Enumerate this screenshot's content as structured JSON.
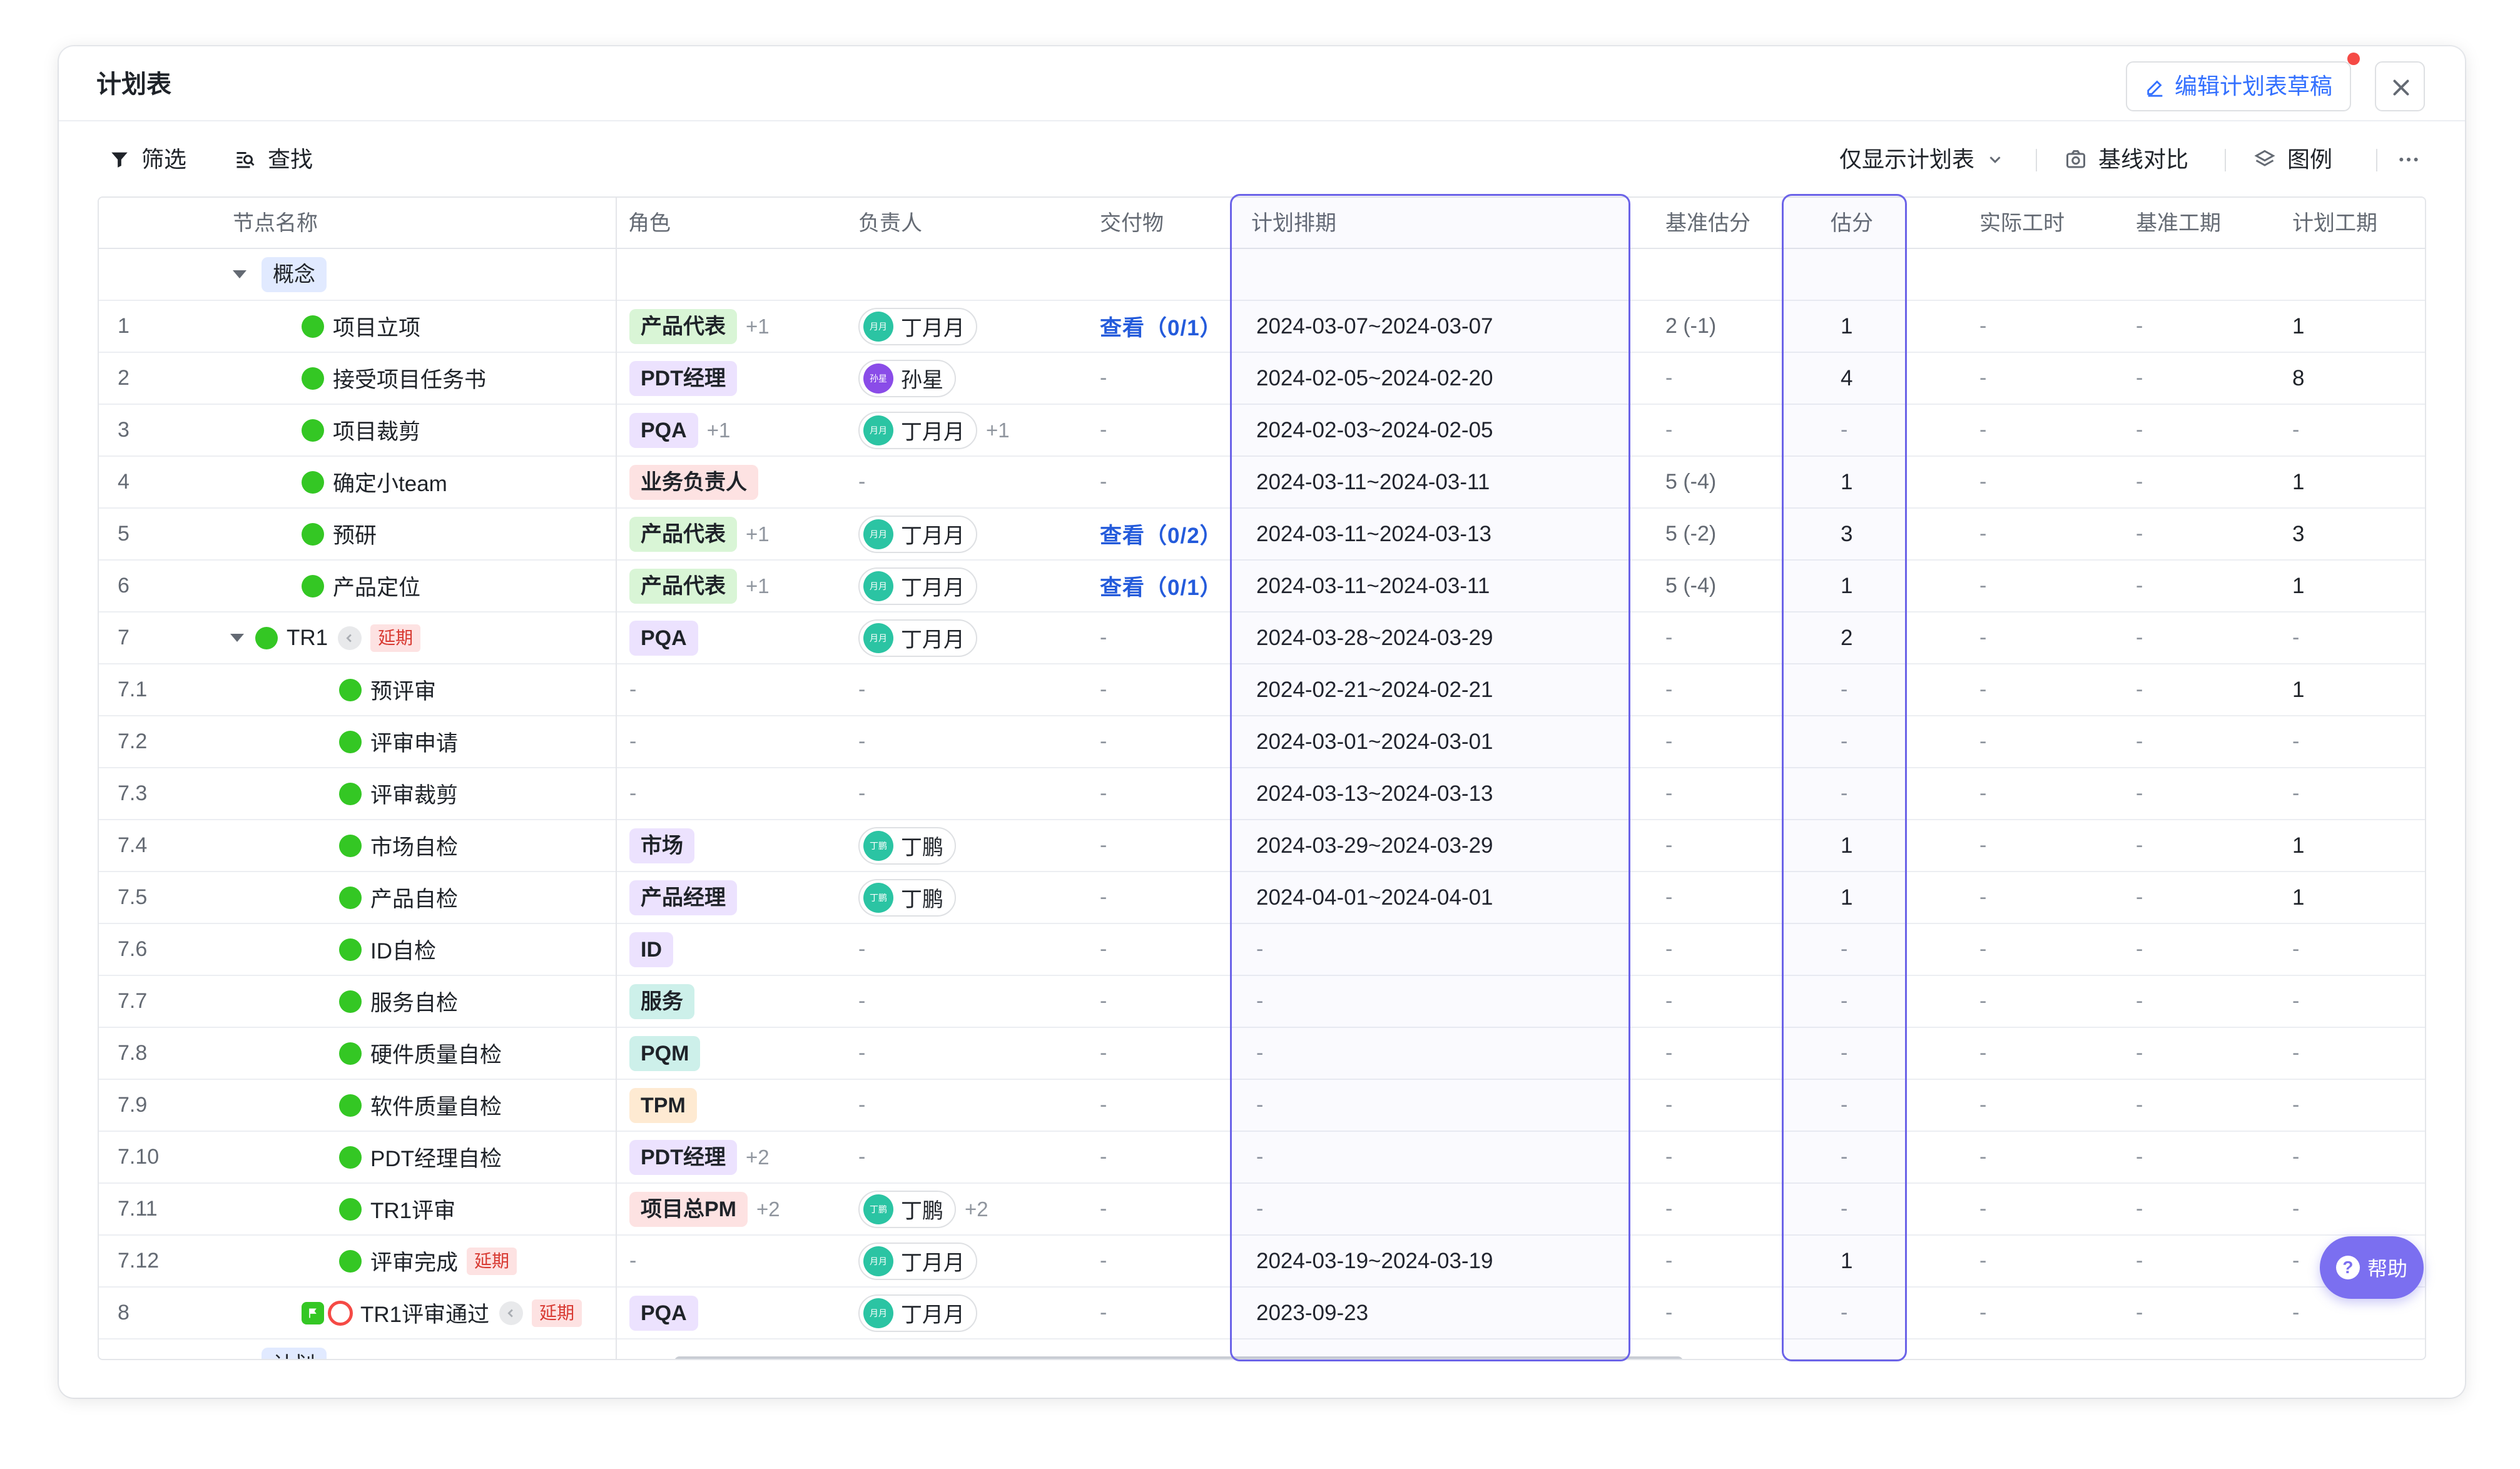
{
  "window": {
    "title": "计划表",
    "edit_button": "编辑计划表草稿"
  },
  "toolbar": {
    "filter": "筛选",
    "find": "查找",
    "show_only": "仅显示计划表",
    "baseline_compare": "基线对比",
    "legend": "图例"
  },
  "columns": [
    "节点名称",
    "角色",
    "负责人",
    "交付物",
    "计划排期",
    "基准估分",
    "估分",
    "实际工时",
    "基准工期",
    "计划工期"
  ],
  "groups": [
    "概念",
    "计划"
  ],
  "delay_tag": "延期",
  "help": "帮助",
  "rows": [
    {
      "no": "1",
      "name": "项目立项",
      "role": "产品代表",
      "role_plus": "+1",
      "owner": "丁月月",
      "owner_plus": "",
      "deliverable": "查看（0/1）",
      "schedule": "2024-03-07~2024-03-07",
      "base_est": "2 (-1)",
      "est": "1",
      "actual": "-",
      "base_dur": "-",
      "plan_dur": "1"
    },
    {
      "no": "2",
      "name": "接受项目任务书",
      "role": "PDT经理",
      "role_plus": "",
      "owner": "孙星",
      "owner_plus": "",
      "deliverable": "-",
      "schedule": "2024-02-05~2024-02-20",
      "base_est": "-",
      "est": "4",
      "actual": "-",
      "base_dur": "-",
      "plan_dur": "8"
    },
    {
      "no": "3",
      "name": "项目裁剪",
      "role": "PQA",
      "role_plus": "+1",
      "owner": "丁月月",
      "owner_plus": "+1",
      "deliverable": "-",
      "schedule": "2024-02-03~2024-02-05",
      "base_est": "-",
      "est": "-",
      "actual": "-",
      "base_dur": "-",
      "plan_dur": "-"
    },
    {
      "no": "4",
      "name": "确定小team",
      "role": "业务负责人",
      "role_plus": "",
      "owner": "-",
      "owner_plus": "",
      "deliverable": "-",
      "schedule": "2024-03-11~2024-03-11",
      "base_est": "5 (-4)",
      "est": "1",
      "actual": "-",
      "base_dur": "-",
      "plan_dur": "1"
    },
    {
      "no": "5",
      "name": "预研",
      "role": "产品代表",
      "role_plus": "+1",
      "owner": "丁月月",
      "owner_plus": "",
      "deliverable": "查看（0/2）",
      "schedule": "2024-03-11~2024-03-13",
      "base_est": "5 (-2)",
      "est": "3",
      "actual": "-",
      "base_dur": "-",
      "plan_dur": "3"
    },
    {
      "no": "6",
      "name": "产品定位",
      "role": "产品代表",
      "role_plus": "+1",
      "owner": "丁月月",
      "owner_plus": "",
      "deliverable": "查看（0/1）",
      "schedule": "2024-03-11~2024-03-11",
      "base_est": "5 (-4)",
      "est": "1",
      "actual": "-",
      "base_dur": "-",
      "plan_dur": "1"
    },
    {
      "no": "7",
      "name": "TR1",
      "role": "PQA",
      "role_plus": "",
      "owner": "丁月月",
      "owner_plus": "",
      "deliverable": "-",
      "schedule": "2024-03-28~2024-03-29",
      "base_est": "-",
      "est": "2",
      "actual": "-",
      "base_dur": "-",
      "plan_dur": "-"
    },
    {
      "no": "7.1",
      "name": "预评审",
      "role": "-",
      "role_plus": "",
      "owner": "-",
      "owner_plus": "",
      "deliverable": "-",
      "schedule": "2024-02-21~2024-02-21",
      "base_est": "-",
      "est": "-",
      "actual": "-",
      "base_dur": "-",
      "plan_dur": "1"
    },
    {
      "no": "7.2",
      "name": "评审申请",
      "role": "-",
      "role_plus": "",
      "owner": "-",
      "owner_plus": "",
      "deliverable": "-",
      "schedule": "2024-03-01~2024-03-01",
      "base_est": "-",
      "est": "-",
      "actual": "-",
      "base_dur": "-",
      "plan_dur": "-"
    },
    {
      "no": "7.3",
      "name": "评审裁剪",
      "role": "-",
      "role_plus": "",
      "owner": "-",
      "owner_plus": "",
      "deliverable": "-",
      "schedule": "2024-03-13~2024-03-13",
      "base_est": "-",
      "est": "-",
      "actual": "-",
      "base_dur": "-",
      "plan_dur": "-"
    },
    {
      "no": "7.4",
      "name": "市场自检",
      "role": "市场",
      "role_plus": "",
      "owner": "丁鹏",
      "owner_plus": "",
      "deliverable": "-",
      "schedule": "2024-03-29~2024-03-29",
      "base_est": "-",
      "est": "1",
      "actual": "-",
      "base_dur": "-",
      "plan_dur": "1"
    },
    {
      "no": "7.5",
      "name": "产品自检",
      "role": "产品经理",
      "role_plus": "",
      "owner": "丁鹏",
      "owner_plus": "",
      "deliverable": "-",
      "schedule": "2024-04-01~2024-04-01",
      "base_est": "-",
      "est": "1",
      "actual": "-",
      "base_dur": "-",
      "plan_dur": "1"
    },
    {
      "no": "7.6",
      "name": "ID自检",
      "role": "ID",
      "role_plus": "",
      "owner": "-",
      "owner_plus": "",
      "deliverable": "-",
      "schedule": "-",
      "base_est": "-",
      "est": "-",
      "actual": "-",
      "base_dur": "-",
      "plan_dur": "-"
    },
    {
      "no": "7.7",
      "name": "服务自检",
      "role": "服务",
      "role_plus": "",
      "owner": "-",
      "owner_plus": "",
      "deliverable": "-",
      "schedule": "-",
      "base_est": "-",
      "est": "-",
      "actual": "-",
      "base_dur": "-",
      "plan_dur": "-"
    },
    {
      "no": "7.8",
      "name": "硬件质量自检",
      "role": "PQM",
      "role_plus": "",
      "owner": "-",
      "owner_plus": "",
      "deliverable": "-",
      "schedule": "-",
      "base_est": "-",
      "est": "-",
      "actual": "-",
      "base_dur": "-",
      "plan_dur": "-"
    },
    {
      "no": "7.9",
      "name": "软件质量自检",
      "role": "TPM",
      "role_plus": "",
      "owner": "-",
      "owner_plus": "",
      "deliverable": "-",
      "schedule": "-",
      "base_est": "-",
      "est": "-",
      "actual": "-",
      "base_dur": "-",
      "plan_dur": "-"
    },
    {
      "no": "7.10",
      "name": "PDT经理自检",
      "role": "PDT经理",
      "role_plus": "+2",
      "owner": "-",
      "owner_plus": "",
      "deliverable": "-",
      "schedule": "-",
      "base_est": "-",
      "est": "-",
      "actual": "-",
      "base_dur": "-",
      "plan_dur": "-"
    },
    {
      "no": "7.11",
      "name": "TR1评审",
      "role": "项目总PM",
      "role_plus": "+2",
      "owner": "丁鹏",
      "owner_plus": "+2",
      "deliverable": "-",
      "schedule": "-",
      "base_est": "-",
      "est": "-",
      "actual": "-",
      "base_dur": "-",
      "plan_dur": "-"
    },
    {
      "no": "7.12",
      "name": "评审完成",
      "role": "-",
      "role_plus": "",
      "owner": "丁月月",
      "owner_plus": "",
      "deliverable": "-",
      "schedule": "2024-03-19~2024-03-19",
      "base_est": "-",
      "est": "1",
      "actual": "-",
      "base_dur": "-",
      "plan_dur": "-"
    },
    {
      "no": "8",
      "name": "TR1评审通过",
      "role": "PQA",
      "role_plus": "",
      "owner": "丁月月",
      "owner_plus": "",
      "deliverable": "-",
      "schedule": "2023-09-23",
      "base_est": "-",
      "est": "-",
      "actual": "-",
      "base_dur": "-",
      "plan_dur": "-"
    }
  ],
  "avatar_initials": {
    "丁月月": "月月",
    "孙星": "孙星",
    "丁鹏": "丁鹏"
  },
  "role_colors": {
    "产品代表": "#d9f5d6",
    "PDT经理": "#ece2fe",
    "PQA": "#ece2fe",
    "业务负责人": "#fde2e2",
    "市场": "#ece2fe",
    "产品经理": "#ece2fe",
    "ID": "#ece2fe",
    "服务": "#cdf0ea",
    "PQM": "#cdf0ea",
    "TPM": "#feead2",
    "项目总PM": "#fde2e2"
  },
  "colors": {
    "accent": "#3370ff",
    "highlight": "#6b63e8",
    "status_green": "#34c724",
    "delay_red": "#d83931"
  },
  "icons": {
    "filter": "filter-icon",
    "find": "find-icon",
    "close": "close-icon",
    "edit": "pen-icon",
    "camera": "camera-icon",
    "layers": "layers-icon",
    "more": "more-icon",
    "help": "help-icon"
  }
}
